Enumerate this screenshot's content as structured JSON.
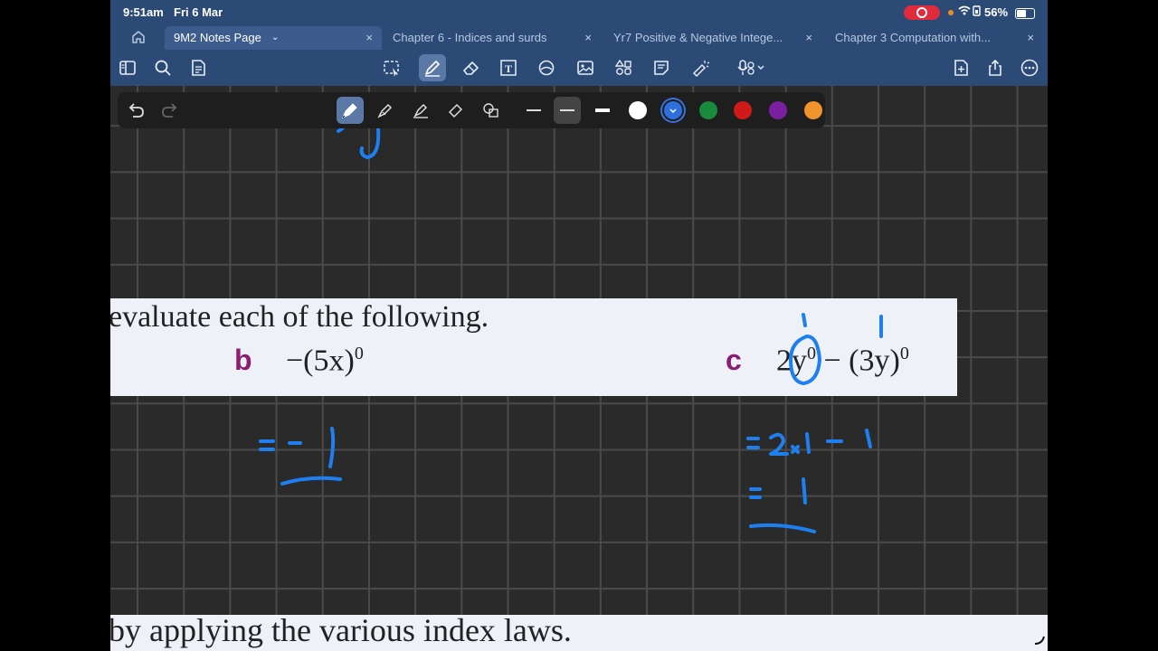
{
  "status": {
    "time": "9:51am",
    "date": "Fri 6 Mar",
    "battery": "56%"
  },
  "tabs": [
    {
      "label": "9M2 Notes Page",
      "active": true
    },
    {
      "label": "Chapter 6 - Indices and surds"
    },
    {
      "label": "Yr7 Positive & Negative Intege..."
    },
    {
      "label": "Chapter 3 Computation with..."
    }
  ],
  "toolbar": {
    "left": [
      "sidebar-icon",
      "search-icon",
      "document-icon"
    ],
    "center": [
      "lasso-icon",
      "pen-icon",
      "eraser-icon",
      "text-icon",
      "shapes-icon",
      "image-icon",
      "elements-icon",
      "sticky-note-icon",
      "laser-icon",
      "mic-icon"
    ],
    "right": [
      "add-page-icon",
      "share-icon",
      "more-icon"
    ]
  },
  "pen_tools": {
    "colors": [
      "#ffffff",
      "#2f6fe0",
      "#1a8a3c",
      "#d01919",
      "#7a1fa0",
      "#f0932b"
    ],
    "selected_color": "#2f6fe0"
  },
  "textbook": {
    "instruction": "evaluate each of the following.",
    "q_b_letter": "b",
    "q_b_expr": "−(5x)",
    "q_b_exp": "0",
    "q_c_letter": "c",
    "q_c_expr": "2y",
    "q_c_exp": "0",
    "q_c_expr2": " − (3y)",
    "q_c_exp2": "0",
    "bottom_text": "by applying the various index laws."
  },
  "ink_color": "#1d7ff0"
}
